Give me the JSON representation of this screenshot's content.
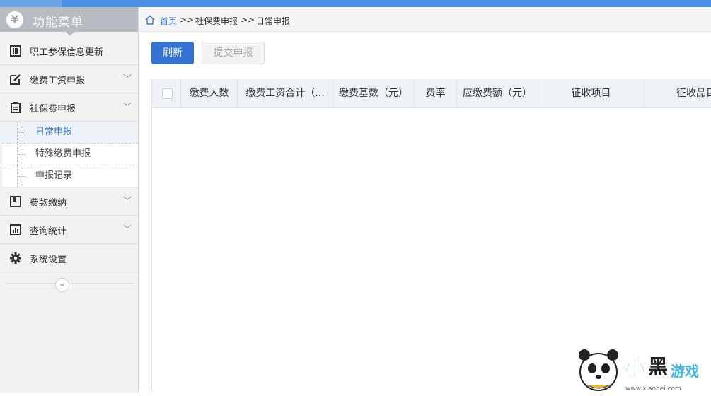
{
  "sidebar": {
    "header_title": "功能菜单",
    "header_icon": "yen-icon",
    "items": [
      {
        "label": "职工参保信息更新",
        "icon": "list-icon",
        "expandable": false
      },
      {
        "label": "缴费工资申报",
        "icon": "edit-icon",
        "expandable": true
      },
      {
        "label": "社保费申报",
        "icon": "clipboard-icon",
        "expandable": true,
        "expanded": true
      },
      {
        "label": "费款缴纳",
        "icon": "book-icon",
        "expandable": true
      },
      {
        "label": "查询统计",
        "icon": "chart-icon",
        "expandable": true
      },
      {
        "label": "系统设置",
        "icon": "gear-icon",
        "expandable": false
      }
    ],
    "submenu": [
      {
        "label": "日常申报",
        "active": true
      },
      {
        "label": "特殊缴费申报",
        "active": false
      },
      {
        "label": "申报记录",
        "active": false
      }
    ],
    "collapse_glyph": "«"
  },
  "breadcrumb": {
    "home": "首页",
    "sep": ">>",
    "level1": "社保费申报",
    "level2": "日常申报"
  },
  "toolbar": {
    "refresh_label": "刷新",
    "submit_label": "提交申报"
  },
  "grid": {
    "columns": [
      "缴费人数",
      "缴费工资合计（...",
      "缴费基数（元）",
      "费率",
      "应缴费额（元）",
      "征收项目",
      "征收品目"
    ],
    "rows": []
  },
  "colors": {
    "accent": "#3473d1",
    "topbar": "#4a90e2",
    "sidebar_header": "#b7bcc2",
    "active_link": "#3a7ecb"
  },
  "watermark": {
    "brand": "小黑游戏",
    "domain": "www.xiaohei.com"
  }
}
